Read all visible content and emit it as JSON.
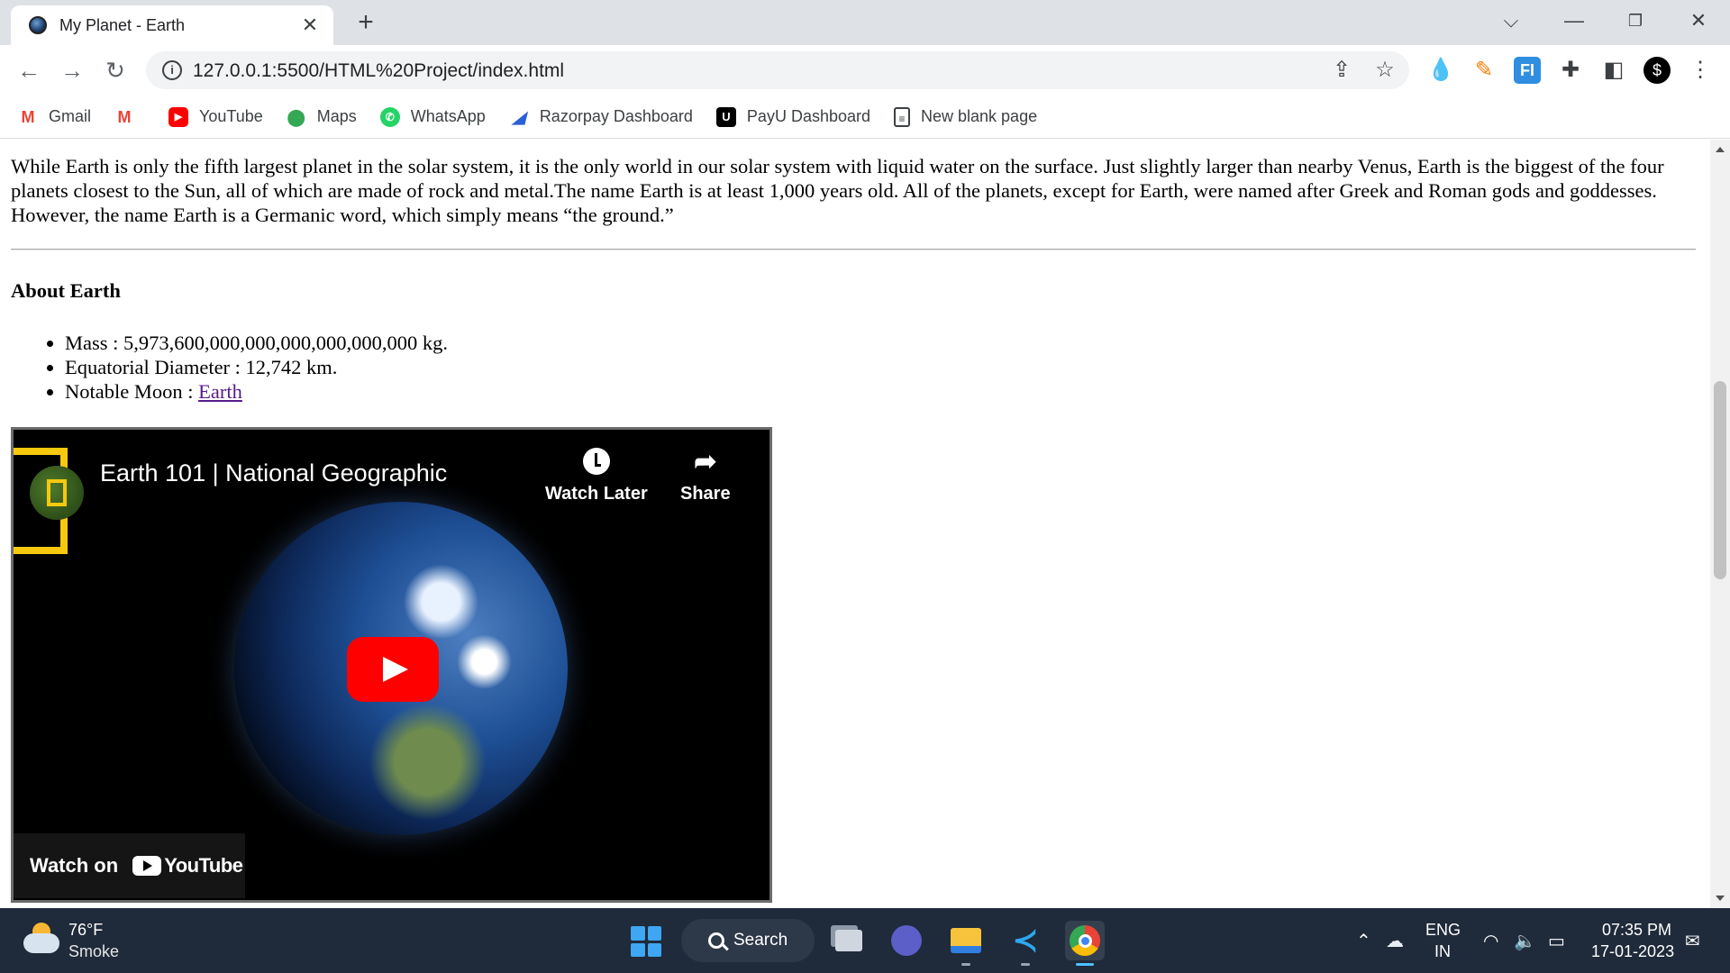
{
  "browser": {
    "tab_title": "My Planet - Earth",
    "url": "127.0.0.1:5500/HTML%20Project/index.html",
    "bookmarks": [
      {
        "label": "Gmail",
        "icon": "gmail-icon"
      },
      {
        "label": "",
        "icon": "gmail-icon"
      },
      {
        "label": "YouTube",
        "icon": "youtube-icon"
      },
      {
        "label": "Maps",
        "icon": "maps-icon"
      },
      {
        "label": "WhatsApp",
        "icon": "whatsapp-icon"
      },
      {
        "label": "Razorpay Dashboard",
        "icon": "razorpay-icon"
      },
      {
        "label": "PayU Dashboard",
        "icon": "payu-icon"
      },
      {
        "label": "New blank page",
        "icon": "document-icon"
      }
    ]
  },
  "page": {
    "intro": "While Earth is only the fifth largest planet in the solar system, it is the only world in our solar system with liquid water on the surface. Just slightly larger than nearby Venus, Earth is the biggest of the four planets closest to the Sun, all of which are made of rock and metal.The name Earth is at least 1,000 years old. All of the planets, except for Earth, were named after Greek and Roman gods and goddesses. However, the name Earth is a Germanic word, which simply means “the ground.”",
    "about_title": "About Earth",
    "facts": [
      {
        "text": "Mass : 5,973,600,000,000,000,000,000,000 kg."
      },
      {
        "text": "Equatorial Diameter : 12,742 km."
      },
      {
        "text": "Notable Moon : ",
        "link": "Earth"
      }
    ],
    "video": {
      "title": "Earth 101 | National Geographic",
      "watch_later": "Watch Later",
      "share": "Share",
      "watch_on": "Watch on",
      "youtube": "YouTube"
    }
  },
  "taskbar": {
    "weather_temp": "76°F",
    "weather_desc": "Smoke",
    "search_label": "Search",
    "lang_top": "ENG",
    "lang_bottom": "IN",
    "time": "07:35 PM",
    "date": "17-01-2023"
  },
  "colors": {
    "link_visited": "#551a8b",
    "yt_red": "#ff0000",
    "natgeo_yellow": "#f6c90e",
    "taskbar_bg": "#1f2a3a"
  }
}
